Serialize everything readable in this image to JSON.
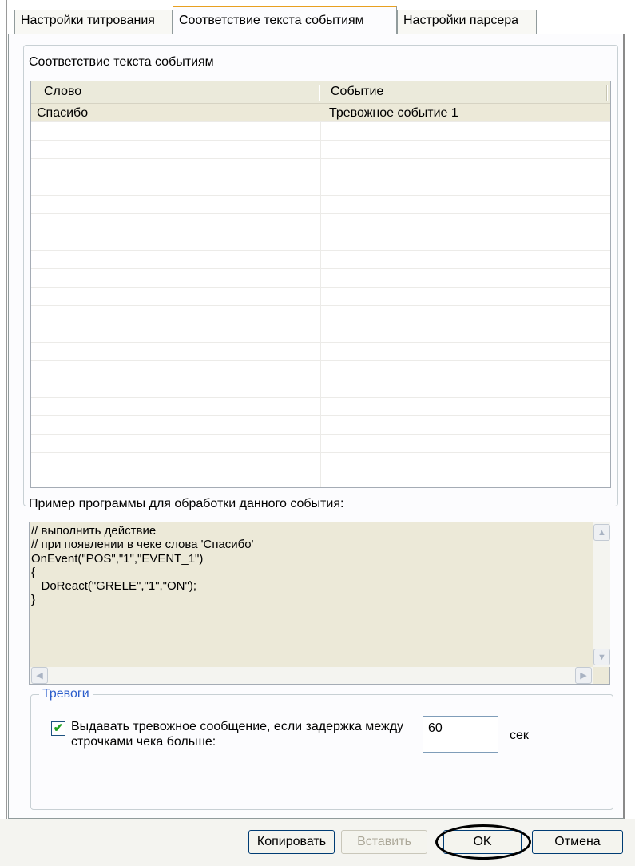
{
  "tabs": [
    {
      "label": "Настройки титрования",
      "active": false
    },
    {
      "label": "Соответствие текста событиям",
      "active": true
    },
    {
      "label": "Настройки парсера",
      "active": false
    }
  ],
  "events_group": {
    "title": "Соответствие текста событиям"
  },
  "table": {
    "columns": [
      "Слово",
      "Событие"
    ],
    "rows": [
      [
        "Спасибо",
        "Тревожное событие 1"
      ]
    ]
  },
  "example": {
    "label": "Пример программы для обработки данного события:",
    "code": "// выполнить действие\n// при появлении в чеке слова 'Спасибо'\nOnEvent(\"POS\",\"1\",\"EVENT_1\")\n{\n   DoReact(\"GRELE\",\"1\",\"ON\");\n}"
  },
  "alarms": {
    "legend": "Тревоги",
    "checkbox_label": "Выдавать тревожное сообщение, если задержка между строчками чека больше:",
    "checked": true,
    "delay_value": "60",
    "unit": "сек"
  },
  "buttons": {
    "copy": "Копировать",
    "paste": "Вставить",
    "ok": "OK",
    "cancel": "Отмена"
  },
  "icons": {
    "scroll_up": "up-arrow-icon",
    "scroll_down": "down-arrow-icon",
    "scroll_left": "left-arrow-icon",
    "scroll_right": "right-arrow-icon",
    "check": "checkmark-icon"
  }
}
